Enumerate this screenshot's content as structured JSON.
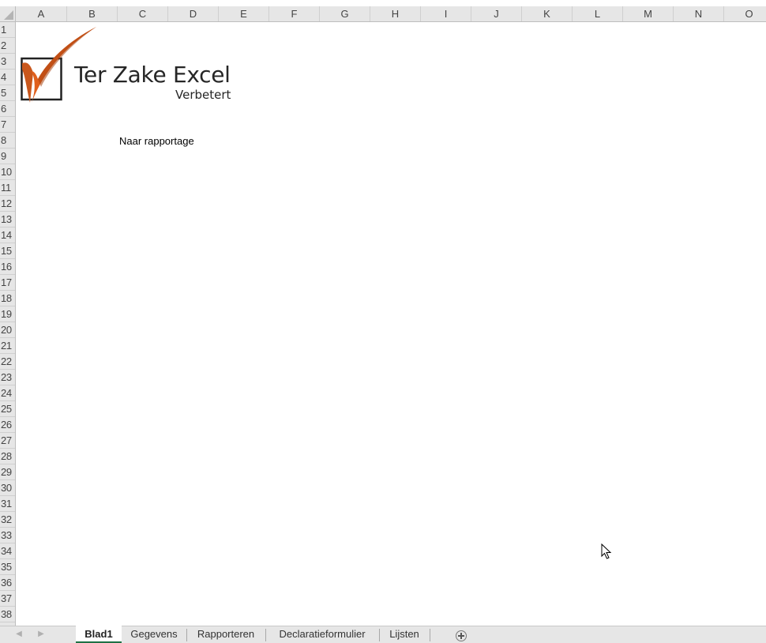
{
  "columns": [
    "A",
    "B",
    "C",
    "D",
    "E",
    "F",
    "G",
    "H",
    "I",
    "J",
    "K",
    "L",
    "M",
    "N",
    "O"
  ],
  "rows": [
    "1",
    "2",
    "3",
    "4",
    "5",
    "6",
    "7",
    "8",
    "9",
    "10",
    "11",
    "12",
    "13",
    "14",
    "15",
    "16",
    "17",
    "18",
    "19",
    "20",
    "21",
    "22",
    "23",
    "24",
    "25",
    "26",
    "27",
    "28",
    "29",
    "30",
    "31",
    "32",
    "33",
    "34",
    "35",
    "36",
    "37",
    "38"
  ],
  "logo": {
    "title": "Ter Zake Excel",
    "subtitle": "Verbetert",
    "accent_color": "#d95a1a"
  },
  "cells": {
    "report_link": "Naar rapportage"
  },
  "sheet_tabs": [
    {
      "label": "Blad1",
      "active": true
    },
    {
      "label": "Gegevens",
      "active": false
    },
    {
      "label": "Rapporteren",
      "active": false
    },
    {
      "label": "Declaratieformulier",
      "active": false
    },
    {
      "label": "Lijsten",
      "active": false
    }
  ],
  "icons": {
    "prev_sheet": "triangle-left-icon",
    "next_sheet": "triangle-right-icon",
    "add_sheet": "plus-circle-icon",
    "cursor": "mouse-pointer-icon"
  }
}
